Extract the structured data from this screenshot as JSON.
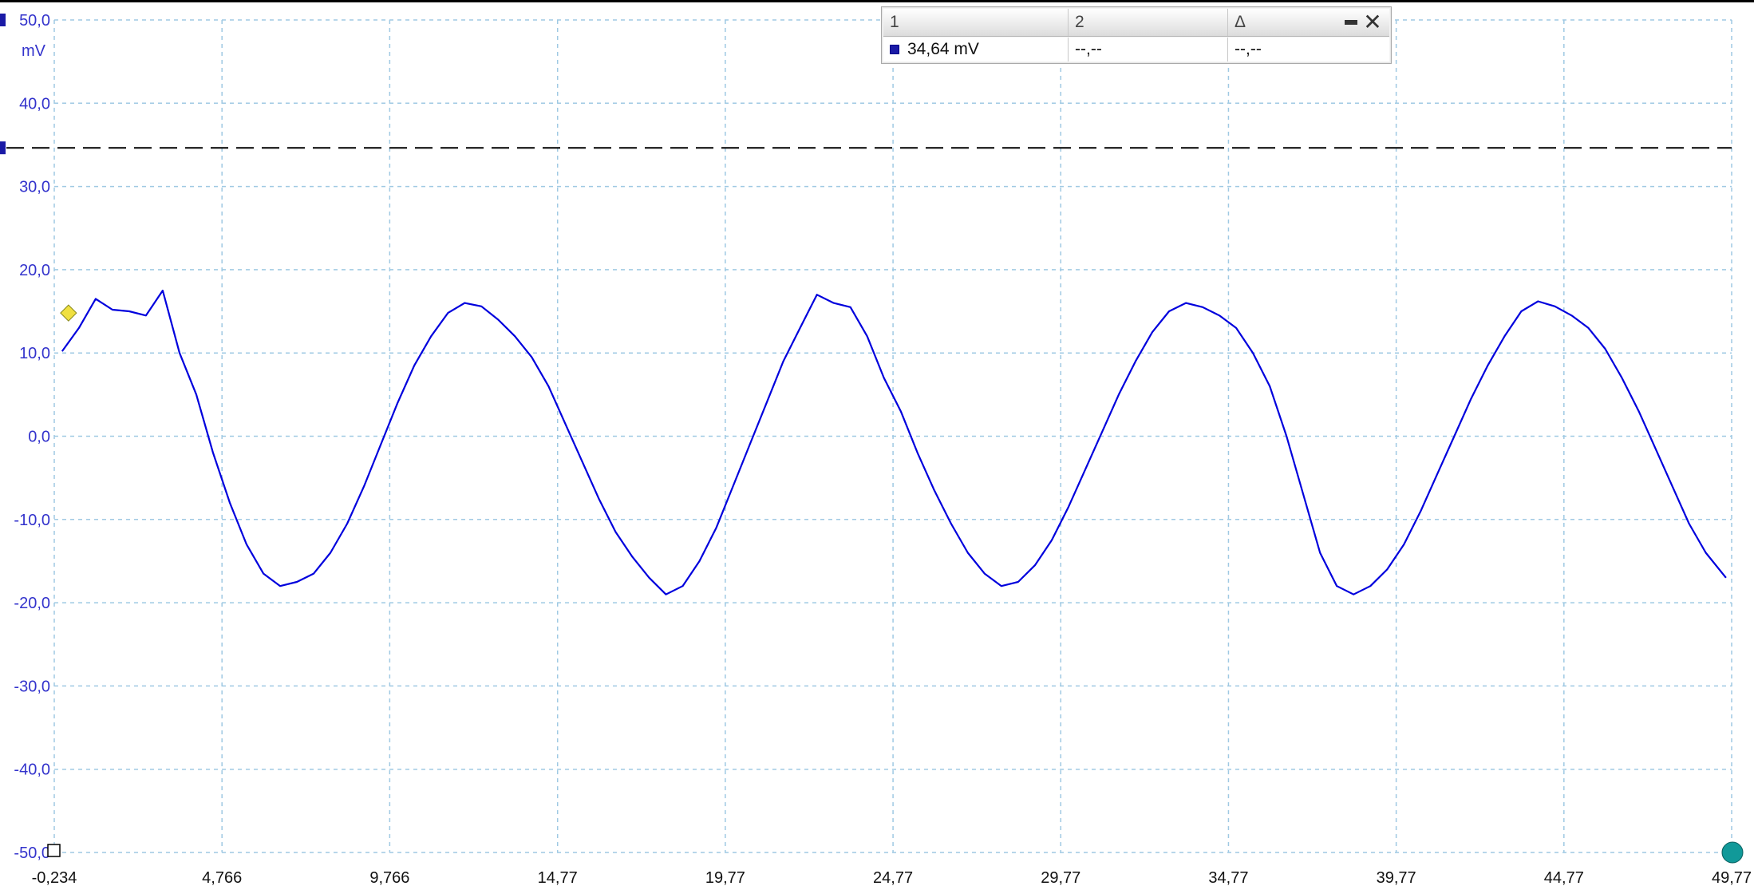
{
  "colors": {
    "trace": "#0000dd",
    "axis_text": "#3333cc",
    "grid": "#9fc9e3",
    "cursor_line": "#000000",
    "marker_trigger": "#f0e040",
    "marker_end": "#119999"
  },
  "readout": {
    "headers": [
      "1",
      "2",
      "Δ"
    ],
    "values": [
      "34,64 mV",
      "--,--",
      "--,--"
    ],
    "minimize_icon": "minimize-icon",
    "close_icon": "close-icon"
  },
  "chart_data": {
    "type": "line",
    "ylabel": "mV",
    "xlim": [
      -0.234,
      49.77
    ],
    "ylim": [
      -50,
      50
    ],
    "y_ticks": [
      50,
      40,
      30,
      20,
      10,
      0,
      -10,
      -20,
      -30,
      -40,
      -50
    ],
    "y_tick_labels": [
      "50,0",
      "40,0",
      "30,0",
      "20,0",
      "10,0",
      "0,0",
      "-10,0",
      "-20,0",
      "-30,0",
      "-40,0",
      "-50,0"
    ],
    "x_ticks": [
      -0.234,
      4.766,
      9.766,
      14.77,
      19.77,
      24.77,
      29.77,
      34.77,
      39.77,
      44.77,
      49.77
    ],
    "x_tick_labels": [
      "-0,234",
      "4,766",
      "9,766",
      "14,77",
      "19,77",
      "24,77",
      "29,77",
      "34,77",
      "39,77",
      "44,77",
      "49,77"
    ],
    "grid": true,
    "cursor_level": 34.64,
    "series": [
      {
        "x": [
          0.0,
          0.5,
          1.0,
          1.5,
          2.0,
          2.5,
          3.0,
          3.5,
          4.0,
          4.5,
          5.0,
          5.5,
          6.0,
          6.5,
          7.0,
          7.5,
          8.0,
          8.5,
          9.0,
          9.5,
          10.0,
          10.5,
          11.0,
          11.5,
          12.0,
          12.5,
          13.0,
          13.5,
          14.0,
          14.5,
          15.0,
          15.5,
          16.0,
          16.5,
          17.0,
          17.5,
          18.0,
          18.5,
          19.0,
          19.5,
          20.0,
          20.5,
          21.0,
          21.5,
          22.0,
          22.5,
          23.0,
          23.5,
          24.0,
          24.5,
          25.0,
          25.5,
          26.0,
          26.5,
          27.0,
          27.5,
          28.0,
          28.5,
          29.0,
          29.5,
          30.0,
          30.5,
          31.0,
          31.5,
          32.0,
          32.5,
          33.0,
          33.5,
          34.0,
          34.5,
          35.0,
          35.5,
          36.0,
          36.5,
          37.0,
          37.5,
          38.0,
          38.5,
          39.0,
          39.5,
          40.0,
          40.5,
          41.0,
          41.5,
          42.0,
          42.5,
          43.0,
          43.5,
          44.0,
          44.5,
          45.0,
          45.5,
          46.0,
          46.5,
          47.0,
          47.5,
          48.0,
          48.5,
          49.0,
          49.6
        ],
        "y": [
          10.2,
          13.0,
          16.5,
          15.2,
          15.0,
          14.5,
          17.5,
          10.0,
          5.0,
          -2.0,
          -8.0,
          -13.0,
          -16.5,
          -18.0,
          -17.5,
          -16.5,
          -14.0,
          -10.5,
          -6.0,
          -1.0,
          4.0,
          8.5,
          12.0,
          14.8,
          16.0,
          15.6,
          14.0,
          12.0,
          9.5,
          6.0,
          1.5,
          -3.0,
          -7.5,
          -11.5,
          -14.5,
          -17.0,
          -19.0,
          -18.0,
          -15.0,
          -11.0,
          -6.0,
          -1.0,
          4.0,
          9.0,
          13.0,
          17.0,
          16.0,
          15.5,
          12.0,
          7.0,
          3.0,
          -2.0,
          -6.5,
          -10.5,
          -14.0,
          -16.5,
          -18.0,
          -17.5,
          -15.5,
          -12.5,
          -8.5,
          -4.0,
          0.5,
          5.0,
          9.0,
          12.5,
          15.0,
          16.0,
          15.5,
          14.5,
          13.0,
          10.0,
          6.0,
          0.0,
          -7.0,
          -14.0,
          -18.0,
          -19.0,
          -18.0,
          -16.0,
          -13.0,
          -9.0,
          -4.5,
          0.0,
          4.5,
          8.5,
          12.0,
          15.0,
          16.2,
          15.6,
          14.5,
          13.0,
          10.5,
          7.0,
          3.0,
          -1.5,
          -6.0,
          -10.5,
          -14.0,
          -17.0
        ]
      }
    ]
  }
}
